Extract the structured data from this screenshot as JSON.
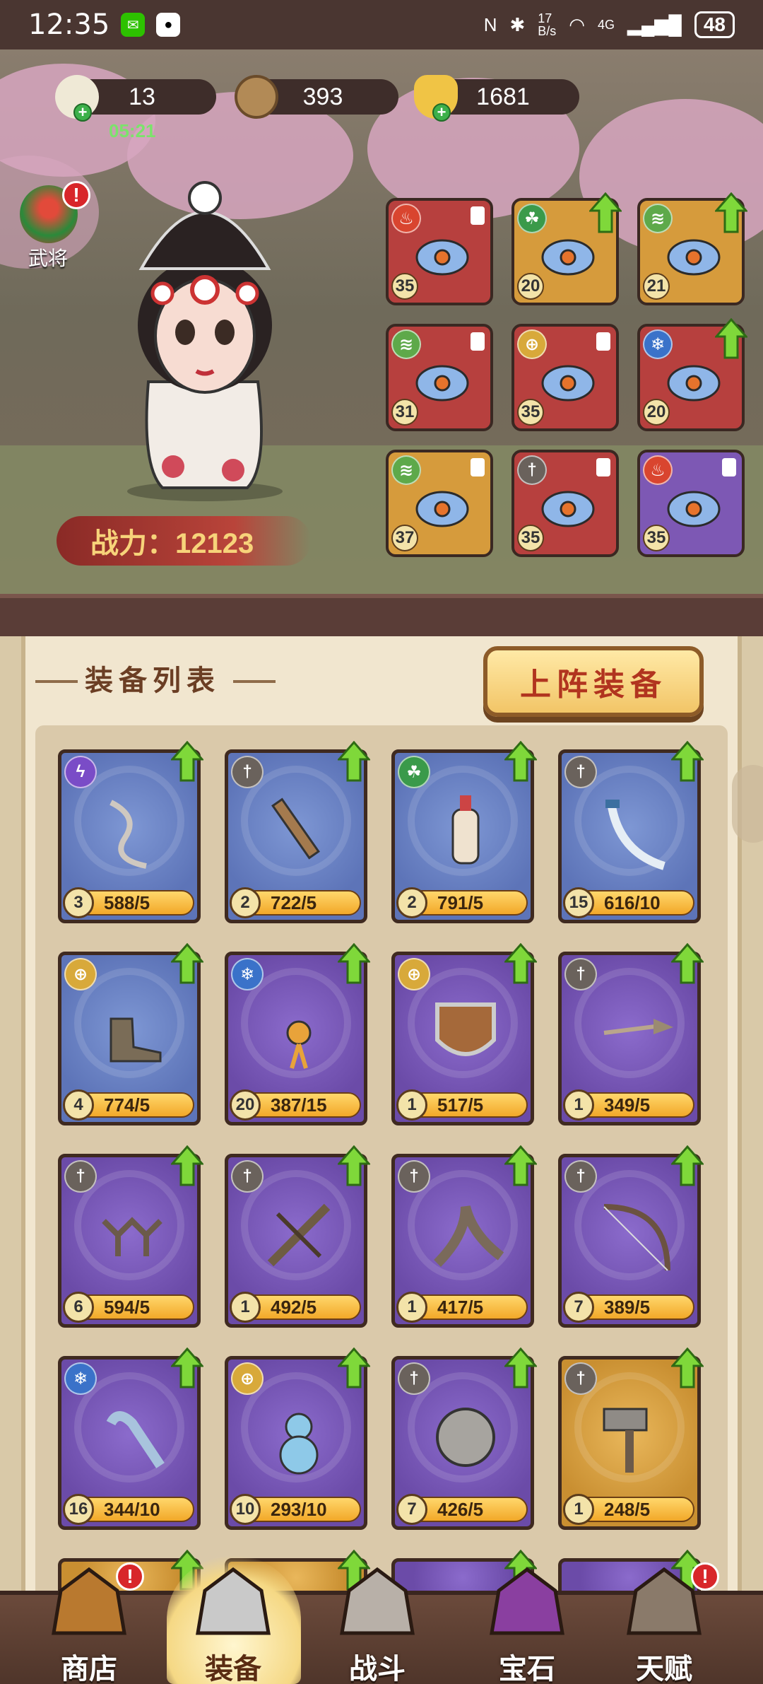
{
  "status_bar": {
    "time": "12:35",
    "net_speed": "17\nB/s",
    "signal": "4G",
    "battery": "48"
  },
  "currencies": [
    {
      "name": "bun",
      "value": "13",
      "timer": "05:21"
    },
    {
      "name": "coin",
      "value": "393"
    },
    {
      "name": "ingot",
      "value": "1681"
    }
  ],
  "hero": {
    "button_label": "武将",
    "badge": "!",
    "power_label": "战力：12123"
  },
  "equipped": [
    {
      "level": "35",
      "rarity": "red",
      "element": "fire",
      "upgradable": false
    },
    {
      "level": "20",
      "rarity": "gold",
      "element": "poison",
      "upgradable": true
    },
    {
      "level": "21",
      "rarity": "gold",
      "element": "wind",
      "upgradable": true
    },
    {
      "level": "31",
      "rarity": "red",
      "element": "wind",
      "upgradable": false
    },
    {
      "level": "35",
      "rarity": "red",
      "element": "holy",
      "upgradable": false
    },
    {
      "level": "20",
      "rarity": "red",
      "element": "ice",
      "upgradable": true
    },
    {
      "level": "37",
      "rarity": "gold",
      "element": "wind",
      "upgradable": false
    },
    {
      "level": "35",
      "rarity": "red",
      "element": "sword",
      "upgradable": false
    },
    {
      "level": "35",
      "rarity": "purple",
      "element": "fire",
      "upgradable": false
    }
  ],
  "list": {
    "title": "装备列表",
    "deploy_button": "上阵装备",
    "items": [
      {
        "level": "3",
        "count": "588/5",
        "rarity": "blue",
        "element": "lightning",
        "art": "whip"
      },
      {
        "level": "2",
        "count": "722/5",
        "rarity": "blue",
        "element": "sword",
        "art": "wooden-sword"
      },
      {
        "level": "2",
        "count": "791/5",
        "rarity": "blue",
        "element": "poison",
        "art": "wine-bottle"
      },
      {
        "level": "15",
        "count": "616/10",
        "rarity": "blue",
        "element": "sword",
        "art": "saber"
      },
      {
        "level": "4",
        "count": "774/5",
        "rarity": "blue",
        "element": "holy",
        "art": "boot"
      },
      {
        "level": "20",
        "count": "387/15",
        "rarity": "purple",
        "element": "ice",
        "art": "tassel-charm"
      },
      {
        "level": "1",
        "count": "517/5",
        "rarity": "purple",
        "element": "holy",
        "art": "shield"
      },
      {
        "level": "1",
        "count": "349/5",
        "rarity": "purple",
        "element": "sword",
        "art": "spear-head"
      },
      {
        "level": "6",
        "count": "594/5",
        "rarity": "purple",
        "element": "sword",
        "art": "caltrops"
      },
      {
        "level": "1",
        "count": "492/5",
        "rarity": "purple",
        "element": "sword",
        "art": "crossbow"
      },
      {
        "level": "1",
        "count": "417/5",
        "rarity": "purple",
        "element": "sword",
        "art": "boomerang"
      },
      {
        "level": "7",
        "count": "389/5",
        "rarity": "purple",
        "element": "sword",
        "art": "bow"
      },
      {
        "level": "16",
        "count": "344/10",
        "rarity": "purple",
        "element": "ice",
        "art": "ruyi"
      },
      {
        "level": "10",
        "count": "293/10",
        "rarity": "purple",
        "element": "holy",
        "art": "gourd"
      },
      {
        "level": "7",
        "count": "426/5",
        "rarity": "purple",
        "element": "sword",
        "art": "iron-ball"
      },
      {
        "level": "1",
        "count": "248/5",
        "rarity": "gold",
        "element": "sword",
        "art": "hammer"
      }
    ]
  },
  "nav": [
    {
      "label": "商店",
      "icon": "shop-icon",
      "badge": "!"
    },
    {
      "label": "装备",
      "icon": "equipment-icon",
      "active": true
    },
    {
      "label": "战斗",
      "icon": "battle-icon"
    },
    {
      "label": "宝石",
      "icon": "gem-chest-icon"
    },
    {
      "label": "天赋",
      "icon": "talent-book-icon",
      "badge": "!"
    }
  ],
  "colors": {
    "element_fire": "#d9452f",
    "element_poison": "#3a9a4a",
    "element_wind": "#5ea94a",
    "element_holy": "#d8a93a",
    "element_ice": "#3a72c9",
    "element_sword": "#6a625c",
    "element_lightning": "#7a4cc7"
  }
}
